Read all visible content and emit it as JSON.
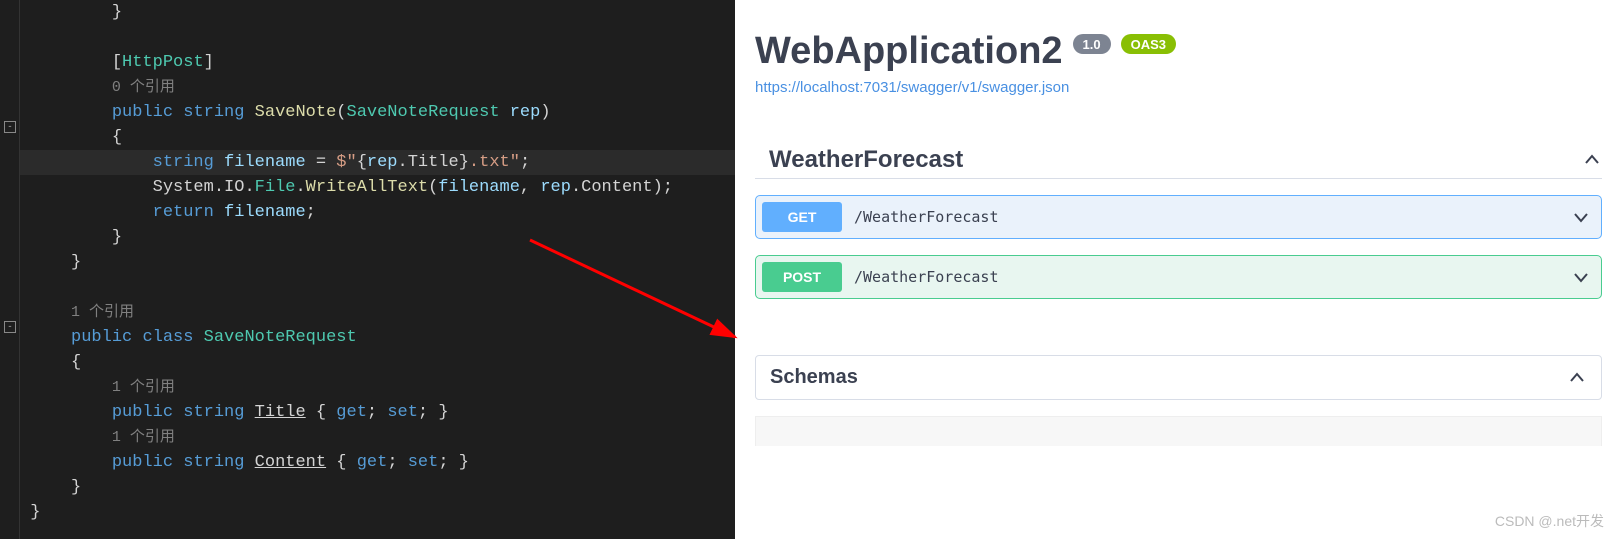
{
  "editor": {
    "lines": [
      {
        "ind": "         ",
        "tokens": [
          {
            "t": "}",
            "c": "c-brace"
          }
        ]
      },
      {
        "ind": "",
        "tokens": []
      },
      {
        "ind": "         ",
        "tokens": [
          {
            "t": "[",
            "c": "c-brace"
          },
          {
            "t": "HttpPost",
            "c": "c-type"
          },
          {
            "t": "]",
            "c": "c-brace"
          }
        ]
      },
      {
        "ind": "         ",
        "tokens": [
          {
            "t": "0 个引用",
            "c": "c-ref"
          }
        ]
      },
      {
        "ind": "         ",
        "tokens": [
          {
            "t": "public ",
            "c": "c-kw"
          },
          {
            "t": "string ",
            "c": "c-kw"
          },
          {
            "t": "SaveNote",
            "c": "c-fn"
          },
          {
            "t": "(",
            "c": "c-brace"
          },
          {
            "t": "SaveNoteRequest ",
            "c": "c-type"
          },
          {
            "t": "rep",
            "c": "c-id"
          },
          {
            "t": ")",
            "c": "c-brace"
          }
        ]
      },
      {
        "ind": "         ",
        "tokens": [
          {
            "t": "{",
            "c": "c-brace"
          }
        ]
      },
      {
        "ind": "             ",
        "hl": true,
        "tokens": [
          {
            "t": "string ",
            "c": "c-kw"
          },
          {
            "t": "filename ",
            "c": "c-id"
          },
          {
            "t": "= ",
            "c": ""
          },
          {
            "t": "$\"",
            "c": "c-str"
          },
          {
            "t": "{",
            "c": ""
          },
          {
            "t": "rep",
            "c": "c-id"
          },
          {
            "t": ".",
            "c": ""
          },
          {
            "t": "Title",
            "c": ""
          },
          {
            "t": "}",
            "c": ""
          },
          {
            "t": ".txt\"",
            "c": "c-str"
          },
          {
            "t": ";",
            "c": ""
          }
        ]
      },
      {
        "ind": "             ",
        "tokens": [
          {
            "t": "System",
            "c": ""
          },
          {
            "t": ".",
            "c": ""
          },
          {
            "t": "IO",
            "c": ""
          },
          {
            "t": ".",
            "c": ""
          },
          {
            "t": "File",
            "c": "c-type"
          },
          {
            "t": ".",
            "c": ""
          },
          {
            "t": "WriteAllText",
            "c": "c-fn"
          },
          {
            "t": "(",
            "c": "c-brace"
          },
          {
            "t": "filename",
            "c": "c-id"
          },
          {
            "t": ", ",
            "c": ""
          },
          {
            "t": "rep",
            "c": "c-id"
          },
          {
            "t": ".",
            "c": ""
          },
          {
            "t": "Content",
            "c": ""
          },
          {
            "t": ");",
            "c": ""
          }
        ]
      },
      {
        "ind": "             ",
        "tokens": [
          {
            "t": "return ",
            "c": "c-kw"
          },
          {
            "t": "filename",
            "c": "c-id"
          },
          {
            "t": ";",
            "c": ""
          }
        ]
      },
      {
        "ind": "         ",
        "tokens": [
          {
            "t": "}",
            "c": "c-brace"
          }
        ]
      },
      {
        "ind": "     ",
        "tokens": [
          {
            "t": "}",
            "c": "c-brace"
          }
        ]
      },
      {
        "ind": "",
        "tokens": []
      },
      {
        "ind": "     ",
        "tokens": [
          {
            "t": "1 个引用",
            "c": "c-ref"
          }
        ]
      },
      {
        "ind": "     ",
        "tokens": [
          {
            "t": "public ",
            "c": "c-kw"
          },
          {
            "t": "class ",
            "c": "c-kw"
          },
          {
            "t": "SaveNoteRequest",
            "c": "c-type"
          }
        ]
      },
      {
        "ind": "     ",
        "tokens": [
          {
            "t": "{",
            "c": "c-brace"
          }
        ]
      },
      {
        "ind": "         ",
        "tokens": [
          {
            "t": "1 个引用",
            "c": "c-ref"
          }
        ]
      },
      {
        "ind": "         ",
        "tokens": [
          {
            "t": "public ",
            "c": "c-kw"
          },
          {
            "t": "string ",
            "c": "c-kw"
          },
          {
            "t": "Title",
            "c": "underline"
          },
          {
            "t": " { ",
            "c": "c-brace"
          },
          {
            "t": "get",
            "c": "c-kw"
          },
          {
            "t": "; ",
            "c": ""
          },
          {
            "t": "set",
            "c": "c-kw"
          },
          {
            "t": "; }",
            "c": "c-brace"
          }
        ]
      },
      {
        "ind": "         ",
        "tokens": [
          {
            "t": "1 个引用",
            "c": "c-ref"
          }
        ]
      },
      {
        "ind": "         ",
        "tokens": [
          {
            "t": "public ",
            "c": "c-kw"
          },
          {
            "t": "string ",
            "c": "c-kw"
          },
          {
            "t": "Content",
            "c": "underline"
          },
          {
            "t": " { ",
            "c": "c-brace"
          },
          {
            "t": "get",
            "c": "c-kw"
          },
          {
            "t": "; ",
            "c": ""
          },
          {
            "t": "set",
            "c": "c-kw"
          },
          {
            "t": "; }",
            "c": "c-brace"
          }
        ]
      },
      {
        "ind": "     ",
        "tokens": [
          {
            "t": "}",
            "c": "c-brace"
          }
        ]
      },
      {
        "ind": " ",
        "tokens": [
          {
            "t": "}",
            "c": "c-brace"
          }
        ]
      }
    ]
  },
  "swagger": {
    "title": "WebApplication2",
    "version": "1.0",
    "oas": "OAS3",
    "url": "https://localhost:7031/swagger/v1/swagger.json",
    "section": "WeatherForecast",
    "ops": [
      {
        "method": "GET",
        "mcls": "m-get",
        "ocls": "op-get",
        "path": "/WeatherForecast"
      },
      {
        "method": "POST",
        "mcls": "m-post",
        "ocls": "op-post",
        "path": "/WeatherForecast"
      }
    ],
    "schemas": "Schemas"
  },
  "watermark": "CSDN @.net开发"
}
